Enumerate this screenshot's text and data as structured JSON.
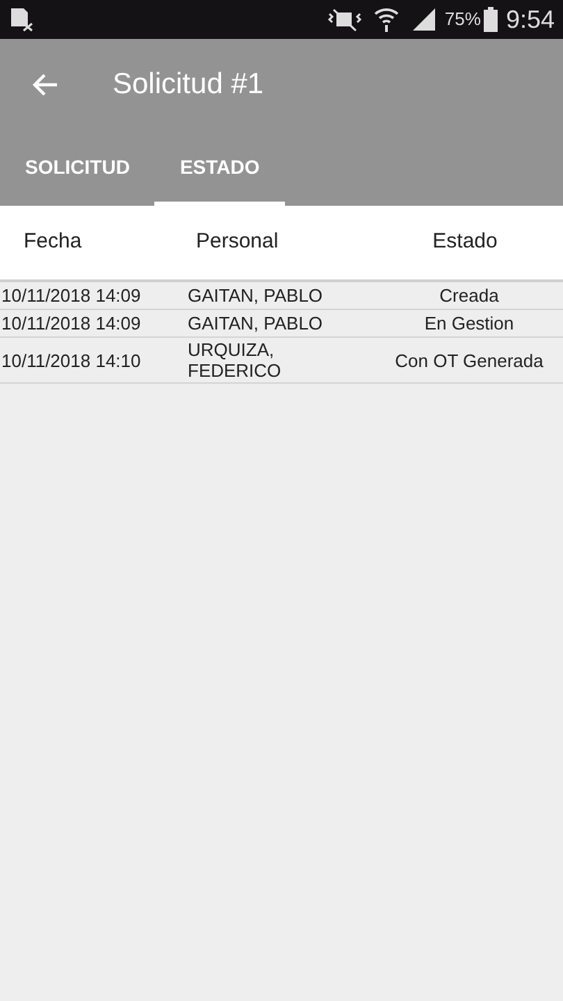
{
  "status_bar": {
    "battery": "75%",
    "time": "9:54"
  },
  "app_bar": {
    "title": "Solicitud #1"
  },
  "tabs": [
    {
      "label": "SOLICITUD",
      "selected": false
    },
    {
      "label": "ESTADO",
      "selected": true
    }
  ],
  "table": {
    "columns": [
      "Fecha",
      "Personal",
      "Estado"
    ],
    "rows": [
      {
        "fecha": "10/11/2018 14:09",
        "personal": "GAITAN, PABLO",
        "estado": "Creada"
      },
      {
        "fecha": "10/11/2018 14:09",
        "personal": "GAITAN, PABLO",
        "estado": "En Gestion"
      },
      {
        "fecha": "10/11/2018 14:10",
        "personal": "URQUIZA, FEDERICO",
        "estado": "Con OT Generada"
      }
    ]
  }
}
